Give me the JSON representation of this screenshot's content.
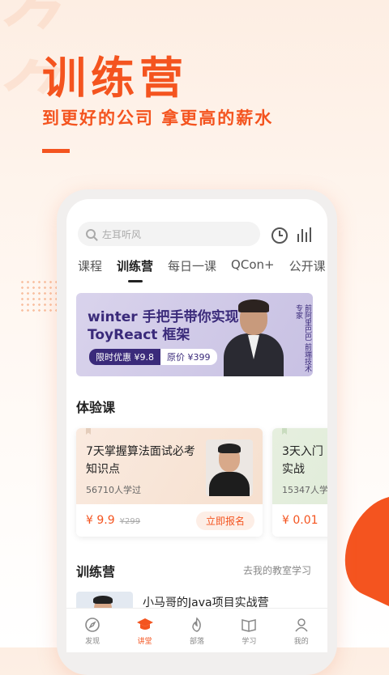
{
  "hero": {
    "title": "训练营",
    "subtitle": "到更好的公司 拿更高的薪水"
  },
  "app": {
    "search": {
      "placeholder": "左耳听风"
    },
    "tabs": [
      {
        "label": "课程"
      },
      {
        "label": "训练营"
      },
      {
        "label": "每日一课"
      },
      {
        "label": "QCon+"
      },
      {
        "label": "公开课"
      }
    ],
    "active_tab": "训练营",
    "banner": {
      "line1": "winter 手把手带你实现",
      "line2": "ToyReact 框架",
      "promo_label": "限时优惠 ¥9.8",
      "original_price": "原价 ¥399",
      "instructor_caption": "程劭非（winter） 前手机淘宝前端负责人 前阿里巴巴 前端技术专家"
    },
    "trial_section": {
      "title": "体验课",
      "cards": [
        {
          "title": "7天掌握算法面试必考知识点",
          "learners": "56710人学过",
          "price": "¥ 9.9",
          "original": "¥299",
          "cta": "立即报名"
        },
        {
          "title": "3天入门实战",
          "learners": "15347人学",
          "price": "¥ 0.01"
        }
      ]
    },
    "bootcamp_section": {
      "title": "训练营",
      "link": "去我的教室学习",
      "item_title": "小马哥的Java项目实战营"
    },
    "tabbar": [
      {
        "label": "发现",
        "icon": "compass-icon"
      },
      {
        "label": "讲堂",
        "icon": "graduation-cap-icon"
      },
      {
        "label": "部落",
        "icon": "flame-icon"
      },
      {
        "label": "学习",
        "icon": "book-icon"
      },
      {
        "label": "我的",
        "icon": "user-icon"
      }
    ],
    "colors": {
      "accent": "#f4541f",
      "banner_text": "#3a2a7a"
    }
  }
}
